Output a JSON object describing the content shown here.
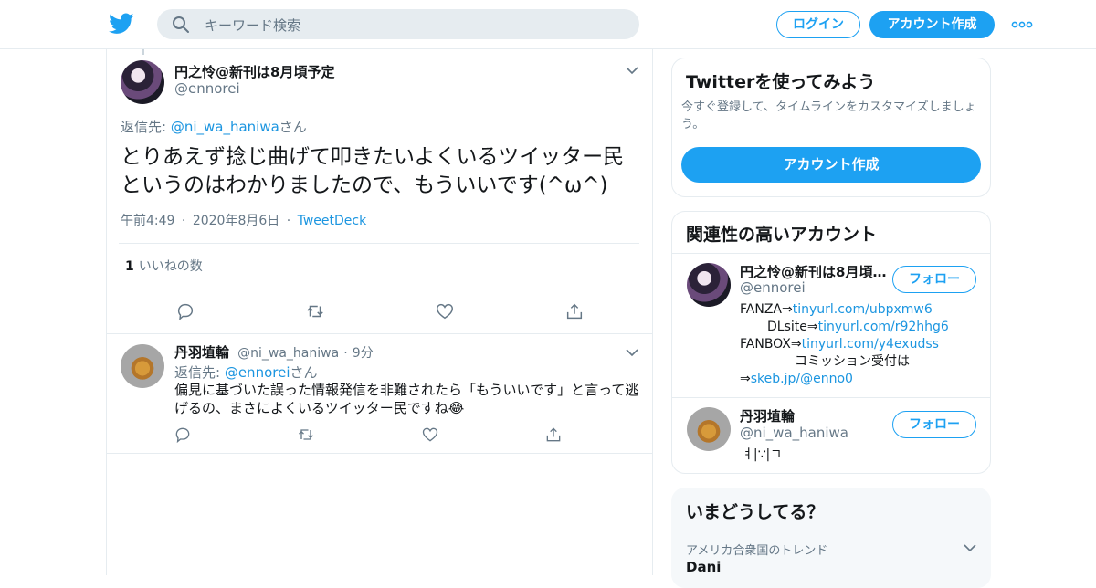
{
  "header": {
    "search_placeholder": "キーワード検索",
    "login_label": "ログイン",
    "signup_label": "アカウント作成"
  },
  "tweet": {
    "author_name": "円之怜@新刊は8月頃予定",
    "author_handle": "@ennorei",
    "reply_prefix": "返信先: ",
    "reply_to": "@ni_wa_haniwa",
    "reply_suffix": "さん",
    "text": "とりあえず捻じ曲げて叩きたいよくいるツイッター民というのはわかりましたので、もういいです(^ω^)",
    "time": "午前4:49",
    "date": "2020年8月6日",
    "client": "TweetDeck",
    "sep": "·",
    "like_count": "1",
    "like_label": "いいねの数"
  },
  "reply": {
    "author_name": "丹羽埴輪",
    "author_handle": "@ni_wa_haniwa",
    "age": "9分",
    "reply_prefix": "返信先: ",
    "reply_to": "@ennorei",
    "reply_suffix": "さん",
    "text": "偏見に基づいた誤った情報発信を非難されたら「もういいです」と言って逃げるの、まさによくいるツイッター民ですね😂"
  },
  "sidebar": {
    "try": {
      "title": "Twitterを使ってみよう",
      "desc": "今すぐ登録して、タイムラインをカスタマイズしましょう。",
      "button": "アカウント作成"
    },
    "related": {
      "title": "関連性の高いアカウント",
      "follow_label": "フォロー",
      "accounts": [
        {
          "name": "円之怜@新刊は8月頃…",
          "handle": "@ennorei",
          "bio": [
            {
              "pre": "FANZA⇒",
              "link": "tinyurl.com/ubpxmw6"
            },
            {
              "pre": "DLsite⇒",
              "link": "tinyurl.com/r92hhg6"
            },
            {
              "pre": "FANBOX⇒",
              "link": "tinyurl.com/y4exudss"
            },
            {
              "pre": "コミッション受付は",
              "link": ""
            },
            {
              "pre": "⇒",
              "link": "skeb.jp/@enno0"
            }
          ]
        },
        {
          "name": "丹羽埴輪",
          "handle": "@ni_wa_haniwa",
          "bio_text": "ㅕ|∵|ㄱ"
        }
      ]
    },
    "trends": {
      "title": "いまどうしてる？",
      "region": "アメリカ合衆国のトレンド",
      "first": "Dani"
    }
  }
}
